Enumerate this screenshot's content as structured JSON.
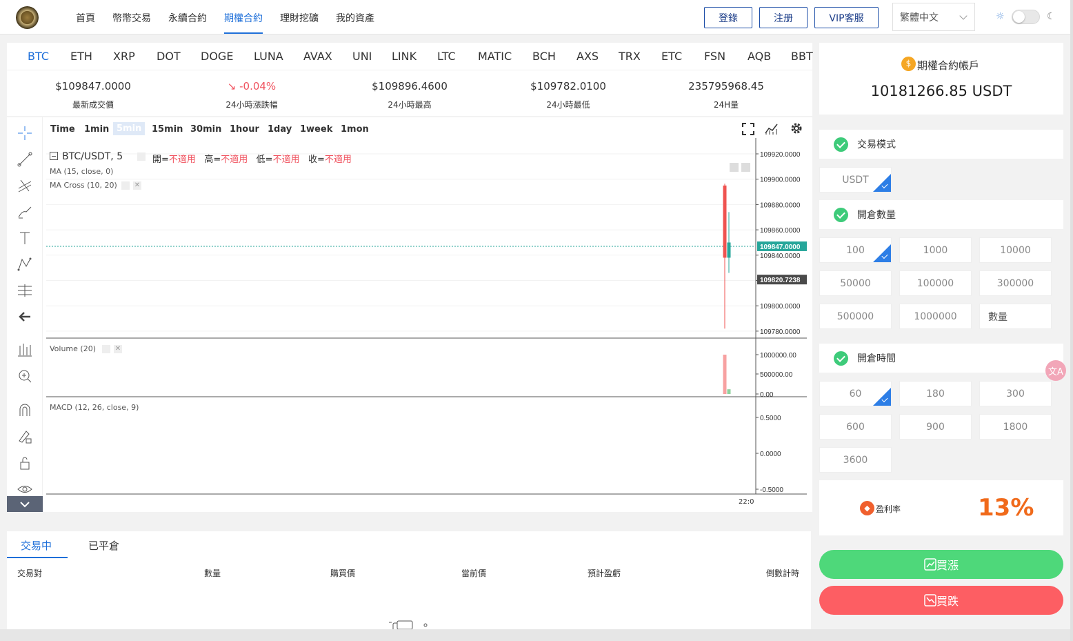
{
  "nav": {
    "items": [
      "首頁",
      "幣幣交易",
      "永續合約",
      "期權合約",
      "理財挖礦",
      "我的資產"
    ],
    "active_index": 3,
    "login": "登錄",
    "register": "注册",
    "vip": "VIP客服",
    "language": "繁體中文"
  },
  "coins": [
    "BTC",
    "ETH",
    "XRP",
    "DOT",
    "DOGE",
    "LUNA",
    "AVAX",
    "UNI",
    "LINK",
    "LTC",
    "MATIC",
    "BCH",
    "AXS",
    "TRX",
    "ETC",
    "FSN",
    "AQB",
    "BBT"
  ],
  "active_coin": "BTC",
  "stats": [
    {
      "value": "$109847.0000",
      "label": "最新成交價"
    },
    {
      "value": "-0.04%",
      "label": "24小時漲跌幅"
    },
    {
      "value": "$109896.4600",
      "label": "24小時最高"
    },
    {
      "value": "$109782.0100",
      "label": "24小時最低"
    },
    {
      "value": "235795968.45",
      "label": "24H量"
    }
  ],
  "chart": {
    "timeframes": [
      "Time",
      "1min",
      "5min",
      "15min",
      "30min",
      "1hour",
      "1day",
      "1week",
      "1mon"
    ],
    "active_timeframe": "5min",
    "symbol": "BTC/USDT, 5",
    "ohlc_labels": {
      "open": "開=",
      "high": "高=",
      "low": "低=",
      "close": "收="
    },
    "ohlc_value": "不適用",
    "indicator_ma": "MA (15, close, 0)",
    "indicator_macross": "MA Cross (10, 20)",
    "indicator_volume": "Volume (20)",
    "indicator_macd": "MACD (12, 26, close, 9)",
    "price_ticks": [
      "109920.0000",
      "109900.0000",
      "109880.0000",
      "109860.0000",
      "109840.0000",
      "109820.0000",
      "109800.0000",
      "109780.0000"
    ],
    "current_price": "109847.0000",
    "cursor_price": "109820.7238",
    "volume_ticks": [
      "1000000.00",
      "500000.00",
      "0.00"
    ],
    "macd_ticks": [
      "0.5000",
      "0.0000",
      "-0.5000"
    ],
    "time_label": "22:0",
    "colors": {
      "up": "#26a69a",
      "down": "#ef5350",
      "current_line": "#26a69a"
    }
  },
  "chart_data": {
    "type": "candlestick",
    "candles": [
      {
        "open": 109895,
        "high": 109896.46,
        "low": 109782.01,
        "close": 109838
      },
      {
        "open": 109838,
        "high": 109874,
        "low": 109826,
        "close": 109850
      }
    ],
    "volume": [
      1000000,
      120000
    ],
    "ylim": [
      109775,
      109925
    ]
  },
  "account": {
    "title": "期權合約帳戶",
    "balance": "10181266.85 USDT"
  },
  "trade_mode": {
    "title": "交易模式",
    "options": [
      "USDT"
    ]
  },
  "open_qty": {
    "title": "開倉數量",
    "options": [
      "100",
      "1000",
      "10000",
      "50000",
      "100000",
      "300000",
      "500000",
      "1000000"
    ],
    "input_placeholder": "數量"
  },
  "open_time": {
    "title": "開倉時間",
    "options": [
      "60",
      "180",
      "300",
      "600",
      "900",
      "1800",
      "3600"
    ]
  },
  "profit": {
    "label": "盈利率",
    "value": "13%"
  },
  "buttons": {
    "buy_up": "買漲",
    "buy_down": "買跌"
  },
  "orders": {
    "tabs": [
      "交易中",
      "已平倉"
    ],
    "columns": [
      "交易對",
      "數量",
      "購買價",
      "當前價",
      "預計盈虧",
      "倒數計時"
    ]
  }
}
